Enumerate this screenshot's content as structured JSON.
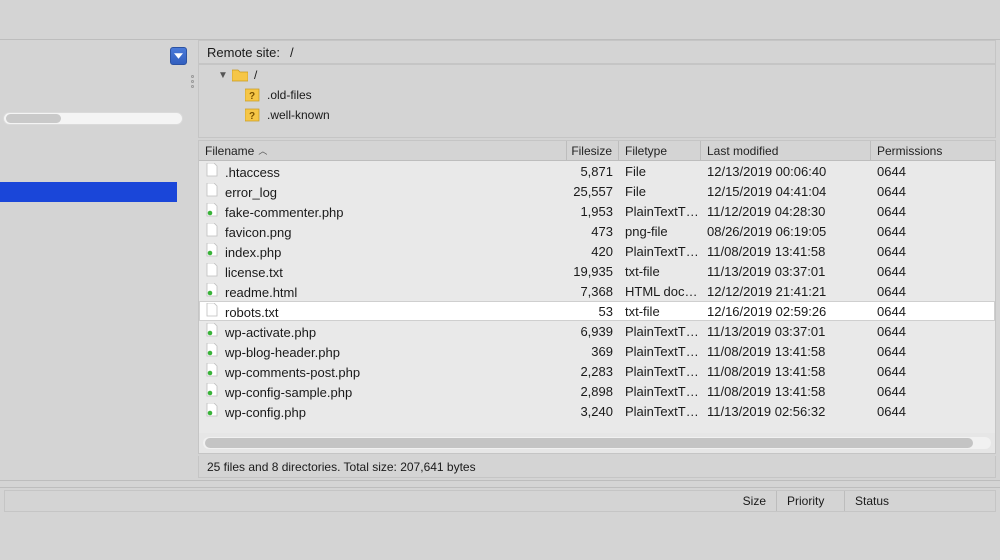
{
  "remote": {
    "label": "Remote site:",
    "path": "/"
  },
  "tree": {
    "root_label": "/",
    "items": [
      {
        "label": ".old-files"
      },
      {
        "label": ".well-known"
      }
    ]
  },
  "columns": {
    "name": "Filename",
    "size": "Filesize",
    "type": "Filetype",
    "modified": "Last modified",
    "permissions": "Permissions"
  },
  "files": [
    {
      "name": ".htaccess",
      "size": "5,871",
      "type": "File",
      "modified": "12/13/2019 00:06:40",
      "perm": "0644",
      "icon": "blank"
    },
    {
      "name": "error_log",
      "size": "25,557",
      "type": "File",
      "modified": "12/15/2019 04:41:04",
      "perm": "0644",
      "icon": "blank"
    },
    {
      "name": "fake-commenter.php",
      "size": "1,953",
      "type": "PlainTextT…",
      "modified": "11/12/2019 04:28:30",
      "perm": "0644",
      "icon": "php"
    },
    {
      "name": "favicon.png",
      "size": "473",
      "type": "png-file",
      "modified": "08/26/2019 06:19:05",
      "perm": "0644",
      "icon": "blank"
    },
    {
      "name": "index.php",
      "size": "420",
      "type": "PlainTextT…",
      "modified": "11/08/2019 13:41:58",
      "perm": "0644",
      "icon": "php"
    },
    {
      "name": "license.txt",
      "size": "19,935",
      "type": "txt-file",
      "modified": "11/13/2019 03:37:01",
      "perm": "0644",
      "icon": "blank"
    },
    {
      "name": "readme.html",
      "size": "7,368",
      "type": "HTML doc…",
      "modified": "12/12/2019 21:41:21",
      "perm": "0644",
      "icon": "php"
    },
    {
      "name": "robots.txt",
      "size": "53",
      "type": "txt-file",
      "modified": "12/16/2019 02:59:26",
      "perm": "0644",
      "icon": "blank",
      "highlight": true
    },
    {
      "name": "wp-activate.php",
      "size": "6,939",
      "type": "PlainTextT…",
      "modified": "11/13/2019 03:37:01",
      "perm": "0644",
      "icon": "php"
    },
    {
      "name": "wp-blog-header.php",
      "size": "369",
      "type": "PlainTextT…",
      "modified": "11/08/2019 13:41:58",
      "perm": "0644",
      "icon": "php"
    },
    {
      "name": "wp-comments-post.php",
      "size": "2,283",
      "type": "PlainTextT…",
      "modified": "11/08/2019 13:41:58",
      "perm": "0644",
      "icon": "php"
    },
    {
      "name": "wp-config-sample.php",
      "size": "2,898",
      "type": "PlainTextT…",
      "modified": "11/08/2019 13:41:58",
      "perm": "0644",
      "icon": "php"
    },
    {
      "name": "wp-config.php",
      "size": "3,240",
      "type": "PlainTextT…",
      "modified": "11/13/2019 02:56:32",
      "perm": "0644",
      "icon": "php"
    }
  ],
  "status_line": "25 files and 8 directories. Total size: 207,641 bytes",
  "queue_columns": {
    "size": "Size",
    "priority": "Priority",
    "status": "Status"
  }
}
